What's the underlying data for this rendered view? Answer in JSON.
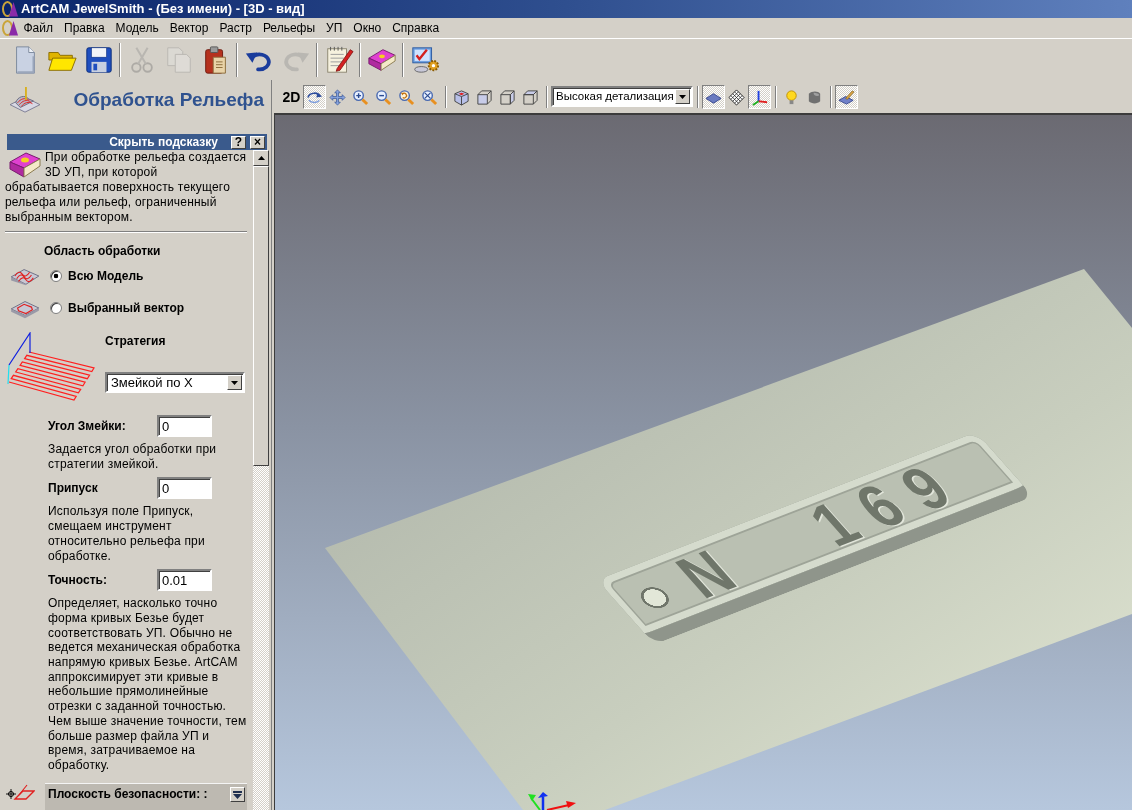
{
  "window": {
    "title": "ArtCAM JewelSmith - (Без имени) - [3D - вид]"
  },
  "menu": [
    "Файл",
    "Правка",
    "Модель",
    "Вектор",
    "Растр",
    "Рельефы",
    "УП",
    "Окно",
    "Справка"
  ],
  "toolbar": [
    [
      {
        "kind": "new",
        "disabled": false
      },
      {
        "kind": "open",
        "disabled": false
      },
      {
        "kind": "save",
        "disabled": false
      }
    ],
    [
      {
        "kind": "cut",
        "disabled": true
      },
      {
        "kind": "copy",
        "disabled": true
      },
      {
        "kind": "paste",
        "disabled": false
      }
    ],
    [
      {
        "kind": "undo",
        "disabled": false
      },
      {
        "kind": "redo",
        "disabled": true
      }
    ],
    [
      {
        "kind": "notes",
        "disabled": false
      }
    ],
    [
      {
        "kind": "help",
        "disabled": false
      }
    ],
    [
      {
        "kind": "wizard",
        "disabled": false
      }
    ]
  ],
  "panel": {
    "title": "Обработка Рельефа",
    "hint": {
      "toggle": "Скрыть подсказку",
      "help": "?",
      "close": "×",
      "text": [
        "При обработке рельефа создается 3D УП, при которой",
        "обрабатывается поверхность текущего рельефа или рельеф, ограниченный выбранным вектором."
      ]
    },
    "area": {
      "label": "Область обработки",
      "options": [
        {
          "kind": "model",
          "label": "Всю Модель",
          "selected": true
        },
        {
          "kind": "vector",
          "label": "Выбранный вектор",
          "selected": false
        }
      ]
    },
    "strategy": {
      "label": "Стратегия",
      "value": "Змейкой по X"
    },
    "fields": [
      {
        "label": "Угол Змейки:",
        "value": "0",
        "help": "Задается угол обработки при стратегии змейкой."
      },
      {
        "label": "Припуск",
        "value": "0",
        "help": "Используя поле Припуск, смещаем инструмент относительно рельефа при обработке."
      },
      {
        "label": "Точность:",
        "value": "0.01",
        "help": "Определяет, насколько точно форма кривых Безье будет соответствовать УП. Обычно не ведется механическая обработка напрямую кривых Безье. ArtCAM аппроксимирует эти кривые в небольшие прямолинейные отрезки с заданной точностью. Чем выше значение точности, тем больше размер файла УП и время, затрачиваемое на обработку."
      }
    ],
    "section": {
      "label": "Плоскость безопасности: :"
    }
  },
  "view_toolbar": [
    [
      {
        "kind": "mode",
        "label": "2D",
        "pressed": false
      },
      {
        "kind": "rotate",
        "pressed": true
      },
      {
        "kind": "pan",
        "pressed": false
      },
      {
        "kind": "zoomin",
        "pressed": false
      },
      {
        "kind": "zoomout",
        "pressed": false
      },
      {
        "kind": "zoomprev",
        "pressed": false
      },
      {
        "kind": "zoomfit",
        "pressed": false
      }
    ],
    [
      {
        "kind": "iso",
        "pressed": false
      },
      {
        "kind": "front",
        "pressed": false
      },
      {
        "kind": "side",
        "pressed": false
      },
      {
        "kind": "top",
        "pressed": false
      }
    ],
    [
      {
        "kind": "detail",
        "value": "Высокая детализация"
      }
    ],
    [
      {
        "kind": "plane",
        "pressed": true
      },
      {
        "kind": "grid",
        "pressed": false
      },
      {
        "kind": "axes",
        "pressed": true
      }
    ],
    [
      {
        "kind": "light",
        "pressed": false
      },
      {
        "kind": "shading",
        "pressed": false
      }
    ],
    [
      {
        "kind": "paint",
        "pressed": true
      }
    ]
  ],
  "model": {
    "engraving": "N 169"
  }
}
